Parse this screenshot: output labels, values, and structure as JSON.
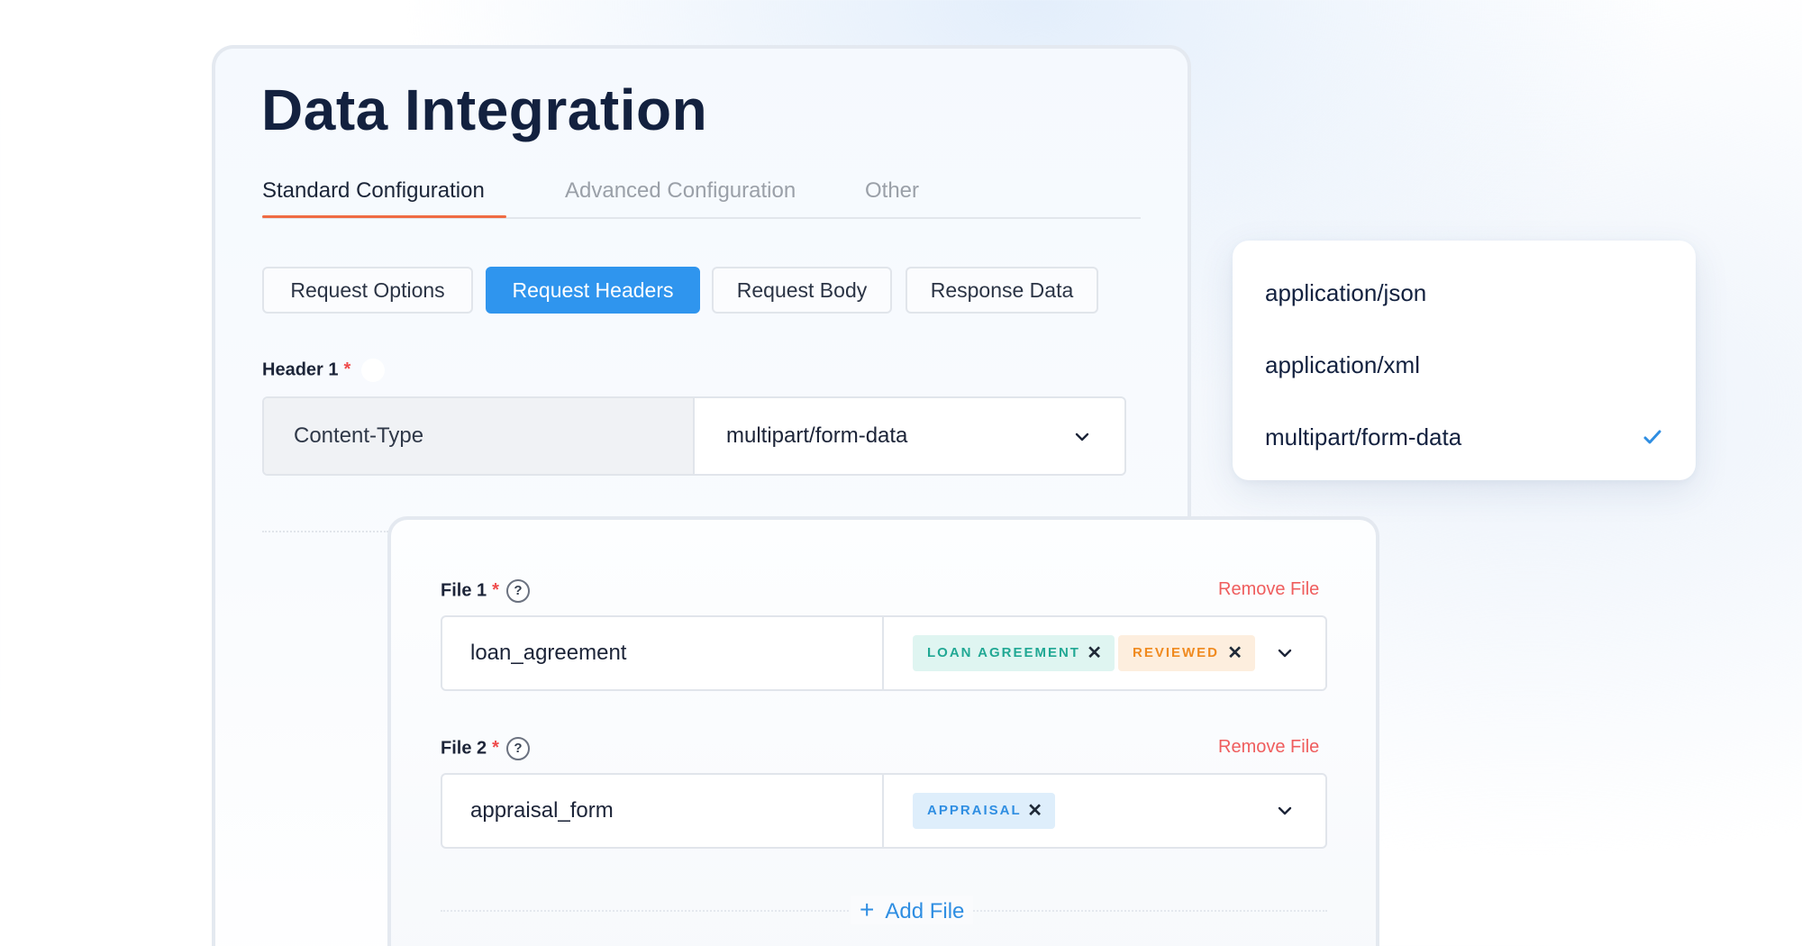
{
  "title": "Data Integration",
  "tabs": [
    {
      "label": "Standard Configuration",
      "active": true
    },
    {
      "label": "Advanced Configuration",
      "active": false
    },
    {
      "label": "Other",
      "active": false
    }
  ],
  "subtabs": [
    {
      "label": "Request Options",
      "active": false
    },
    {
      "label": "Request Headers",
      "active": true
    },
    {
      "label": "Request Body",
      "active": false
    },
    {
      "label": "Response Data",
      "active": false
    }
  ],
  "header1": {
    "label": "Header 1",
    "required_mark": "*",
    "key": "Content-Type",
    "value": "multipart/form-data",
    "dropdown_icon": "chevron-down-icon"
  },
  "files": [
    {
      "label": "File 1",
      "required_mark": "*",
      "help": "?",
      "remove_label": "Remove File",
      "name": "loan_agreement",
      "tags": [
        {
          "label": "LOAN AGREEMENT",
          "color": "#21a894"
        },
        {
          "label": "REVIEWED",
          "color": "#f08a1f"
        }
      ]
    },
    {
      "label": "File 2",
      "required_mark": "*",
      "help": "?",
      "remove_label": "Remove File",
      "name": "appraisal_form",
      "tags": [
        {
          "label": "APPRAISAL",
          "color": "#2f8ee2"
        }
      ]
    }
  ],
  "add_file": {
    "label": "Add File",
    "icon": "plus-icon"
  },
  "content_type_dropdown": {
    "options": [
      {
        "label": "application/json",
        "selected": false
      },
      {
        "label": "application/xml",
        "selected": false
      },
      {
        "label": "multipart/form-data",
        "selected": true
      }
    ],
    "selected_icon": "check-icon"
  },
  "colors": {
    "accent": "#2f95ee",
    "tab_underline": "#ef6b43",
    "required": "#ef4b4b",
    "remove_link": "#ef5d5d",
    "title": "#13213f"
  }
}
